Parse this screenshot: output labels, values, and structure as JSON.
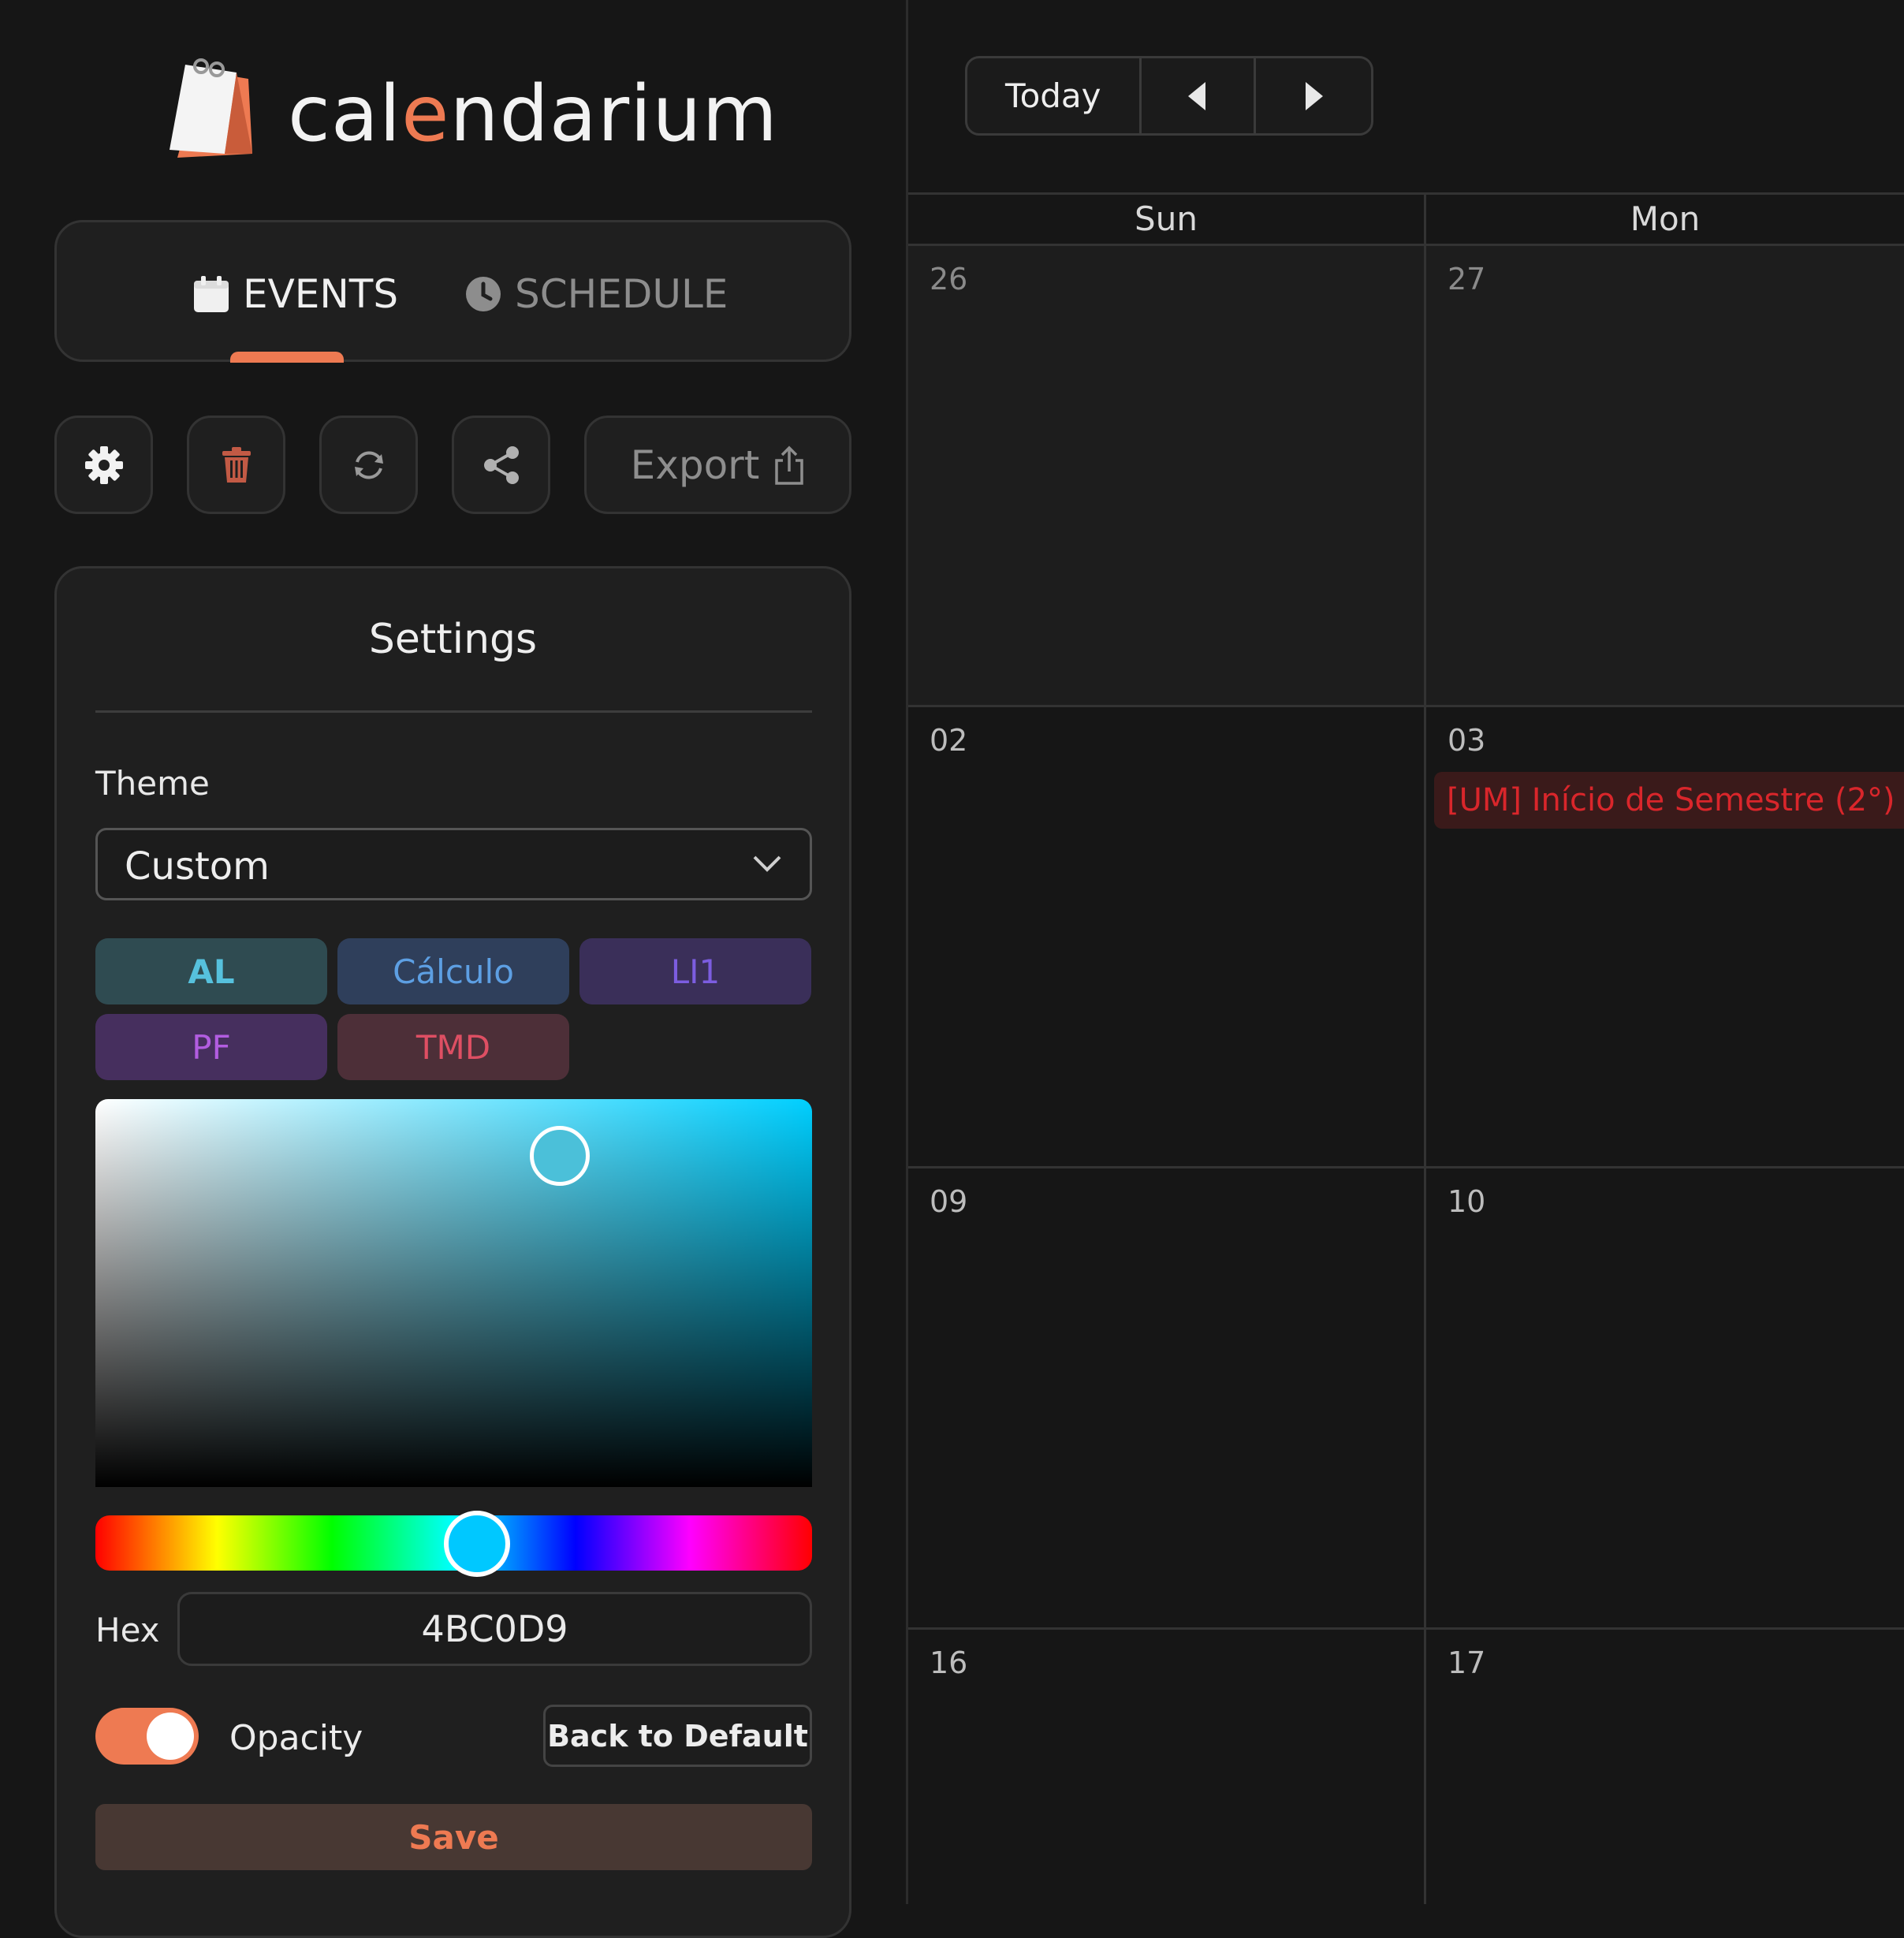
{
  "app": {
    "logo_parts": [
      "cal",
      "e",
      "ndarium"
    ],
    "accent_color": "#ee7a52"
  },
  "tabs": [
    {
      "label": "EVENTS",
      "icon": "calendar-icon",
      "active": true
    },
    {
      "label": "SCHEDULE",
      "icon": "clock-icon",
      "active": false
    }
  ],
  "toolbar": {
    "buttons": [
      "gear-icon",
      "trash-icon",
      "refresh-icon",
      "share-icon"
    ],
    "export_label": "Export"
  },
  "settings": {
    "title": "Settings",
    "theme_label": "Theme",
    "theme_value": "Custom",
    "chips": [
      {
        "label": "AL",
        "bg": "#2f4b51",
        "fg": "#56c1dd",
        "bold": true
      },
      {
        "label": "Cálculo",
        "bg": "#2f3f5b",
        "fg": "#5d9fe3",
        "bold": false
      },
      {
        "label": "LI1",
        "bg": "#3a2f59",
        "fg": "#7c5de0",
        "bold": false
      },
      {
        "label": "PF",
        "bg": "#462f5e",
        "fg": "#b25de0",
        "bold": false
      },
      {
        "label": "TMD",
        "bg": "#4d2f38",
        "fg": "#de4f63",
        "bold": false
      }
    ],
    "hex_label": "Hex",
    "hex_value": "4BC0D9",
    "opacity_label": "Opacity",
    "opacity_on": true,
    "default_label": "Back to Default",
    "save_label": "Save"
  },
  "calendar": {
    "today_label": "Today",
    "day_headers": [
      "Sun",
      "Mon"
    ],
    "weeks": [
      [
        "26",
        "27"
      ],
      [
        "02",
        "03"
      ],
      [
        "09",
        "10"
      ],
      [
        "16",
        "17"
      ]
    ],
    "event": {
      "label": "[UM] Início de Semestre (2°)",
      "color": "#d9262b"
    }
  }
}
